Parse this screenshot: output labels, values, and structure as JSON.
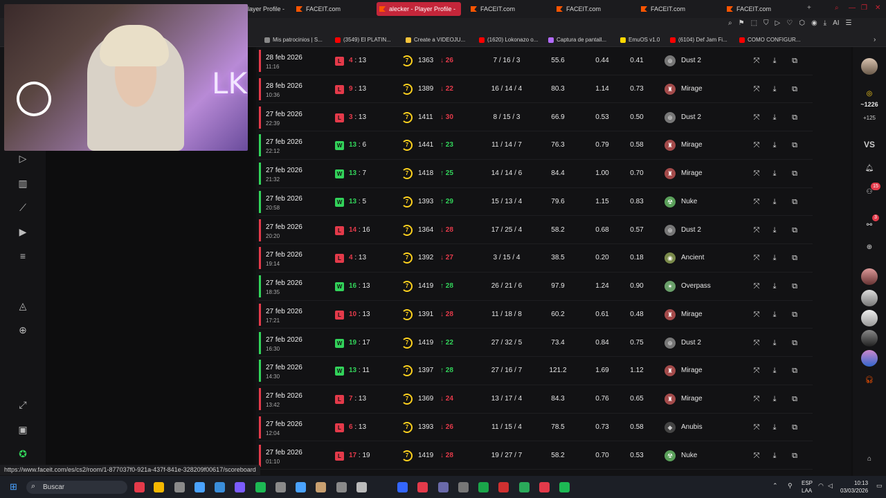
{
  "browser": {
    "tabs": [
      {
        "label": "layer Profile -",
        "active": false
      },
      {
        "label": "FACEIT.com",
        "active": false
      },
      {
        "label": "alecker - Player Profile -",
        "active": true
      },
      {
        "label": "FACEIT.com",
        "active": false
      },
      {
        "label": "FACEIT.com",
        "active": false
      },
      {
        "label": "FACEIT.com",
        "active": false
      },
      {
        "label": "FACEIT.com",
        "active": false
      }
    ],
    "new_tab": "+",
    "ai_label": "AI",
    "bookmarks": [
      {
        "label": "Mis patrocinios | S...",
        "color": "#888888"
      },
      {
        "label": "(3549) El PLATIN...",
        "color": "#ff0000"
      },
      {
        "label": "Create a VIDEOJU...",
        "color": "#f5c33b"
      },
      {
        "label": "(1620) Lokonazo o...",
        "color": "#ff0000"
      },
      {
        "label": "Captura de pantall...",
        "color": "#b36bff"
      },
      {
        "label": "EmuOS v1.0",
        "color": "#ffd700"
      },
      {
        "label": "(6104) Def Jam Fi...",
        "color": "#ff0000"
      },
      {
        "label": "COMO CONFIGUR...",
        "color": "#ff0000"
      }
    ]
  },
  "webcam": {
    "neon_text": "LKZ"
  },
  "matches": [
    {
      "date": "28 feb 2026",
      "time": "11:16",
      "result": "L",
      "my_score": "4",
      "opp_score": "13",
      "level": "7",
      "elo": "1363",
      "delta": "26",
      "up": false,
      "kda": "7 / 16 / 3",
      "adr": "55.6",
      "kd": "0.44",
      "kr": "0.41",
      "map": "Dust 2"
    },
    {
      "date": "28 feb 2026",
      "time": "10:36",
      "result": "L",
      "my_score": "9",
      "opp_score": "13",
      "level": "7",
      "elo": "1389",
      "delta": "22",
      "up": false,
      "kda": "16 / 14 / 4",
      "adr": "80.3",
      "kd": "1.14",
      "kr": "0.73",
      "map": "Mirage"
    },
    {
      "date": "27 feb 2026",
      "time": "22:39",
      "result": "L",
      "my_score": "3",
      "opp_score": "13",
      "level": "7",
      "elo": "1411",
      "delta": "30",
      "up": false,
      "kda": "8 / 15 / 3",
      "adr": "66.9",
      "kd": "0.53",
      "kr": "0.50",
      "map": "Dust 2"
    },
    {
      "date": "27 feb 2026",
      "time": "22:12",
      "result": "W",
      "my_score": "13",
      "opp_score": "6",
      "level": "7",
      "elo": "1441",
      "delta": "23",
      "up": true,
      "kda": "11 / 14 / 7",
      "adr": "76.3",
      "kd": "0.79",
      "kr": "0.58",
      "map": "Mirage"
    },
    {
      "date": "27 feb 2026",
      "time": "21:32",
      "result": "W",
      "my_score": "13",
      "opp_score": "7",
      "level": "7",
      "elo": "1418",
      "delta": "25",
      "up": true,
      "kda": "14 / 14 / 6",
      "adr": "84.4",
      "kd": "1.00",
      "kr": "0.70",
      "map": "Mirage"
    },
    {
      "date": "27 feb 2026",
      "time": "20:58",
      "result": "W",
      "my_score": "13",
      "opp_score": "5",
      "level": "7",
      "elo": "1393",
      "delta": "29",
      "up": true,
      "kda": "15 / 13 / 4",
      "adr": "79.6",
      "kd": "1.15",
      "kr": "0.83",
      "map": "Nuke"
    },
    {
      "date": "27 feb 2026",
      "time": "20:20",
      "result": "L",
      "my_score": "14",
      "opp_score": "16",
      "level": "7",
      "elo": "1364",
      "delta": "28",
      "up": false,
      "kda": "17 / 25 / 4",
      "adr": "58.2",
      "kd": "0.68",
      "kr": "0.57",
      "map": "Dust 2"
    },
    {
      "date": "27 feb 2026",
      "time": "19:14",
      "result": "L",
      "my_score": "4",
      "opp_score": "13",
      "level": "7",
      "elo": "1392",
      "delta": "27",
      "up": false,
      "kda": "3 / 15 / 4",
      "adr": "38.5",
      "kd": "0.20",
      "kr": "0.18",
      "map": "Ancient"
    },
    {
      "date": "27 feb 2026",
      "time": "18:35",
      "result": "W",
      "my_score": "16",
      "opp_score": "13",
      "level": "7",
      "elo": "1419",
      "delta": "28",
      "up": true,
      "kda": "26 / 21 / 6",
      "adr": "97.9",
      "kd": "1.24",
      "kr": "0.90",
      "map": "Overpass"
    },
    {
      "date": "27 feb 2026",
      "time": "17:21",
      "result": "L",
      "my_score": "10",
      "opp_score": "13",
      "level": "7",
      "elo": "1391",
      "delta": "28",
      "up": false,
      "kda": "11 / 18 / 8",
      "adr": "60.2",
      "kd": "0.61",
      "kr": "0.48",
      "map": "Mirage"
    },
    {
      "date": "27 feb 2026",
      "time": "16:30",
      "result": "W",
      "my_score": "19",
      "opp_score": "17",
      "level": "7",
      "elo": "1419",
      "delta": "22",
      "up": true,
      "kda": "27 / 32 / 5",
      "adr": "73.4",
      "kd": "0.84",
      "kr": "0.75",
      "map": "Dust 2"
    },
    {
      "date": "27 feb 2026",
      "time": "14:30",
      "result": "W",
      "my_score": "13",
      "opp_score": "11",
      "level": "7",
      "elo": "1397",
      "delta": "28",
      "up": true,
      "kda": "27 / 16 / 7",
      "adr": "121.2",
      "kd": "1.69",
      "kr": "1.12",
      "map": "Mirage"
    },
    {
      "date": "27 feb 2026",
      "time": "13:42",
      "result": "L",
      "my_score": "7",
      "opp_score": "13",
      "level": "7",
      "elo": "1369",
      "delta": "24",
      "up": false,
      "kda": "13 / 17 / 4",
      "adr": "84.3",
      "kd": "0.76",
      "kr": "0.65",
      "map": "Mirage"
    },
    {
      "date": "27 feb 2026",
      "time": "12:04",
      "result": "L",
      "my_score": "6",
      "opp_score": "13",
      "level": "7",
      "elo": "1393",
      "delta": "26",
      "up": false,
      "kda": "11 / 15 / 4",
      "adr": "78.5",
      "kd": "0.73",
      "kr": "0.58",
      "map": "Anubis"
    },
    {
      "date": "27 feb 2026",
      "time": "01:10",
      "result": "L",
      "my_score": "17",
      "opp_score": "19",
      "level": "7",
      "elo": "1419",
      "delta": "28",
      "up": false,
      "kda": "19 / 27 / 7",
      "adr": "58.2",
      "kd": "0.70",
      "kr": "0.53",
      "map": "Nuke"
    }
  ],
  "right_sidebar": {
    "points": "~1226",
    "points_delta": "+125",
    "vs_label": "VS",
    "friend_badge": "15",
    "party_badge": "3"
  },
  "status_url": "https://www.faceit.com/es/cs2/room/1-877037f0-921a-437f-841e-328209f00617/scoreboard",
  "taskbar": {
    "search_placeholder": "Buscar",
    "lang_line1": "ESP",
    "lang_line2": "LAA",
    "time": "10:13",
    "date": "03/03/2026"
  }
}
